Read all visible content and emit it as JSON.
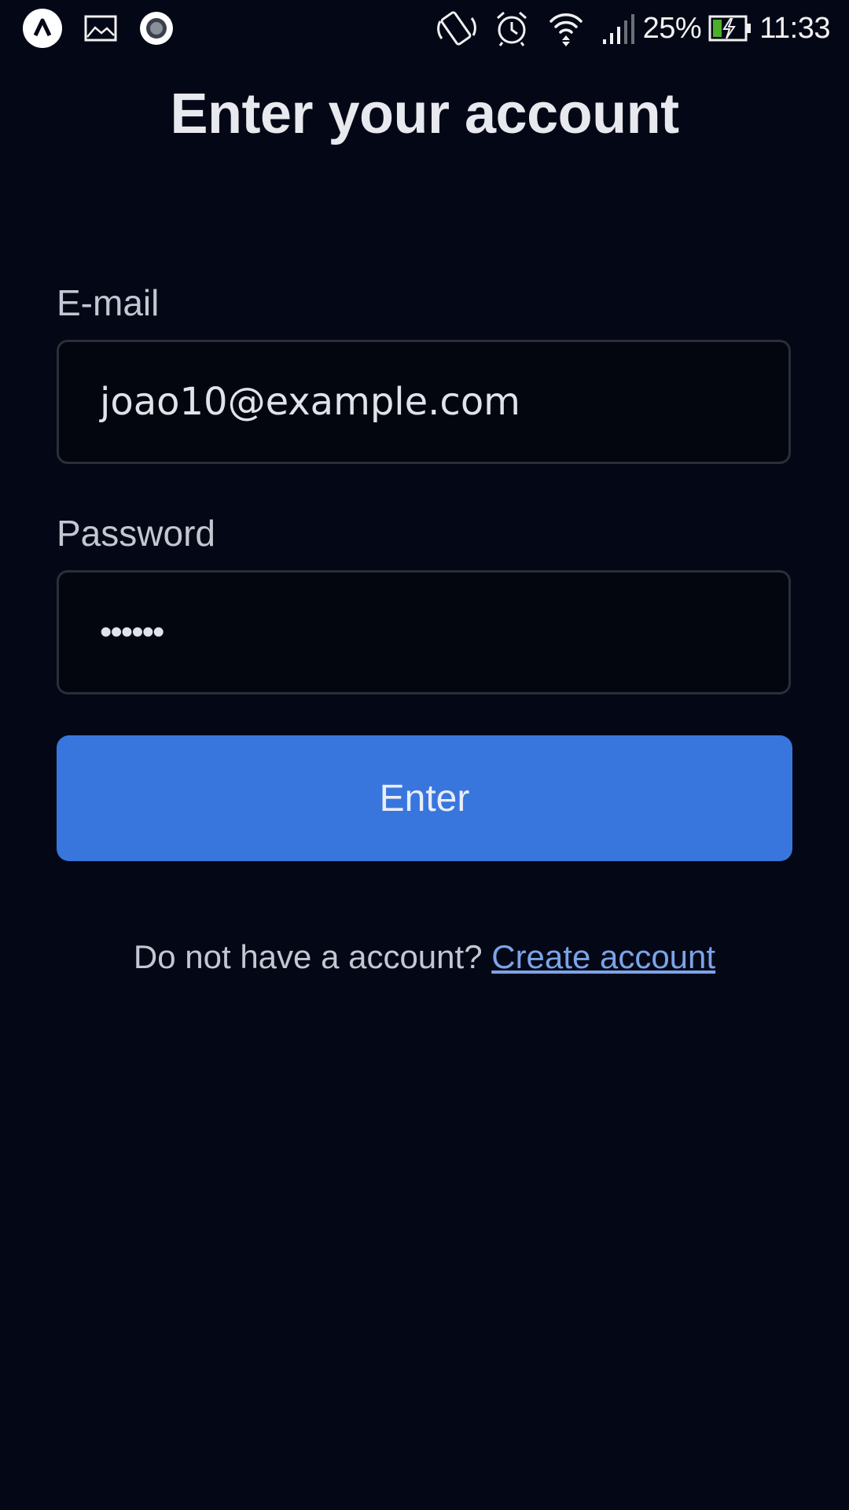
{
  "status_bar": {
    "left_icons": [
      "app-launcher-icon",
      "gallery-icon",
      "record-icon"
    ],
    "right_icons": [
      "rotate-icon",
      "alarm-icon",
      "wifi-icon",
      "signal-icon",
      "battery-charging-icon"
    ],
    "battery_percent": "25%",
    "time": "11:33"
  },
  "page": {
    "title": "Enter your account"
  },
  "form": {
    "email_label": "E-mail",
    "email_value": "joao10@example.com",
    "password_label": "Password",
    "password_value": "••••••",
    "submit_label": "Enter"
  },
  "footer": {
    "prompt": "Do not have a account?",
    "link_label": "Create account"
  },
  "colors": {
    "background": "#040816",
    "primary_button": "#3876de",
    "link": "#7ba3e8"
  }
}
